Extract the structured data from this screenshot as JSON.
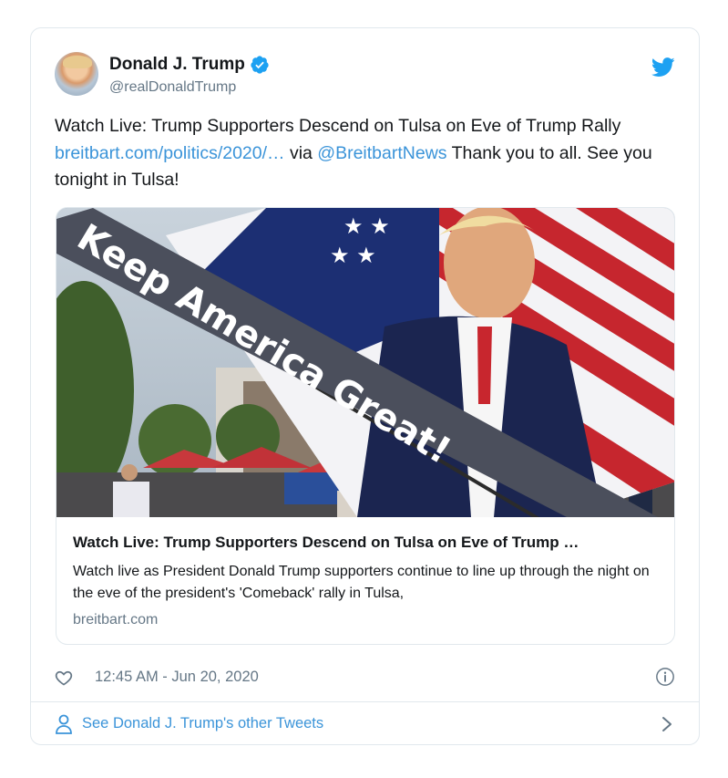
{
  "tweet": {
    "author_name": "Donald J. Trump",
    "handle": "@realDonaldTrump",
    "text_1": "Watch Live: Trump Supporters Descend on Tulsa on Eve of Trump Rally ",
    "link_1": "breitbart.com/politics/2020/…",
    "text_2": " via ",
    "mention": "@BreitbartNews",
    "text_3": " Thank you to all. See you tonight in Tulsa!",
    "timestamp": "12:45 AM - Jun 20, 2020"
  },
  "card": {
    "title": "Watch Live: Trump Supporters Descend on Tulsa on Eve of Trump …",
    "description": "Watch live as President Donald Trump supporters continue to line up through the night on the eve of the president's 'Comeback' rally in Tulsa,",
    "domain": "breitbart.com",
    "image_banner_text": "Keep America Great!"
  },
  "footer": {
    "see_more": "See Donald J. Trump's other Tweets"
  },
  "icons": {
    "verified": "verified-badge-icon",
    "twitter": "twitter-bird-icon",
    "like": "heart-icon",
    "info": "info-icon",
    "person": "person-icon",
    "chevron": "chevron-right-icon"
  },
  "colors": {
    "link": "#3b94d9",
    "muted": "#657786",
    "border": "#e1e8ed",
    "twitter_blue": "#1da1f2"
  }
}
